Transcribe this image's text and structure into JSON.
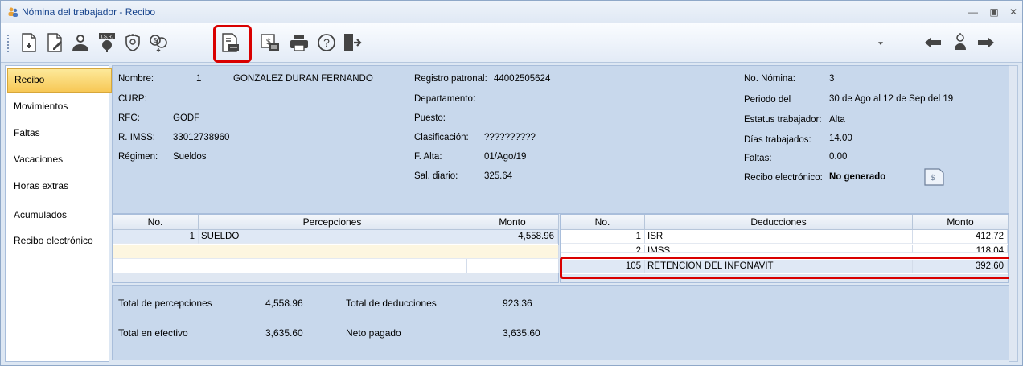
{
  "window": {
    "title": "Nómina del trabajador - Recibo"
  },
  "sidebar": {
    "items": [
      {
        "label": "Recibo"
      },
      {
        "label": "Movimientos"
      },
      {
        "label": "Faltas"
      },
      {
        "label": "Vacaciones"
      },
      {
        "label": "Horas extras"
      },
      {
        "label": "Acumulados"
      },
      {
        "label": "Recibo electrónico"
      }
    ]
  },
  "toolbar": {
    "isr_badge": "I.S.R."
  },
  "employee": {
    "nombre_label": "Nombre:",
    "nombre_num": "1",
    "nombre": "GONZALEZ DURAN FERNANDO",
    "curp_label": "CURP:",
    "curp": "",
    "rfc_label": "RFC:",
    "rfc": "GODF",
    "imss_label": "R. IMSS:",
    "imss": "33012738960",
    "regimen_label": "Régimen:",
    "regimen": "Sueldos",
    "registro_label": "Registro patronal:",
    "registro": "44002505624",
    "departamento_label": "Departamento:",
    "departamento": "",
    "puesto_label": "Puesto:",
    "puesto": "",
    "clasificacion_label": "Clasificación:",
    "clasificacion": "??????????",
    "alta_label": "F. Alta:",
    "alta": "01/Ago/19",
    "salario_label": "Sal. diario:",
    "salario": "325.64",
    "nomina_label": "No. Nómina:",
    "nomina": "3",
    "periodo_label": "Periodo del",
    "periodo": "30 de Ago al 12 de Sep del 19",
    "estatus_label": "Estatus trabajador:",
    "estatus": "Alta",
    "dias_label": "Días trabajados:",
    "dias": "14.00",
    "faltas_label": "Faltas:",
    "faltas": "0.00",
    "recibo_label": "Recibo electrónico:",
    "recibo": "No generado"
  },
  "percepciones": {
    "headers": {
      "no": "No.",
      "concepto": "Percepciones",
      "monto": "Monto"
    },
    "rows": [
      {
        "no": "1",
        "concepto": "SUELDO",
        "monto": "4,558.96"
      }
    ]
  },
  "deducciones": {
    "headers": {
      "no": "No.",
      "concepto": "Deducciones",
      "monto": "Monto"
    },
    "rows": [
      {
        "no": "1",
        "concepto": "ISR",
        "monto": "412.72"
      },
      {
        "no": "2",
        "concepto": "IMSS",
        "monto": "118.04"
      },
      {
        "no": "105",
        "concepto": "RETENCION DEL INFONAVIT",
        "monto": "392.60"
      }
    ]
  },
  "totals": {
    "percepciones_label": "Total de percepciones",
    "percepciones": "4,558.96",
    "deducciones_label": "Total de deducciones",
    "deducciones": "923.36",
    "efectivo_label": "Total en efectivo",
    "efectivo": "3,635.60",
    "neto_label": "Neto pagado",
    "neto": "3,635.60"
  },
  "colors": {
    "highlight": "#d90000",
    "title": "#15428b",
    "active_tab": "#f7c856"
  }
}
